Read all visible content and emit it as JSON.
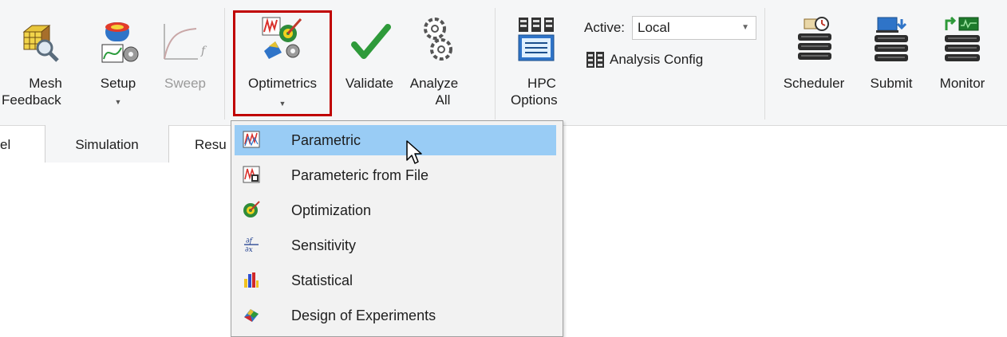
{
  "ribbon": {
    "mesh_line1": "Mesh",
    "mesh_line2": "Feedback",
    "setup": "Setup",
    "sweep": "Sweep",
    "optimetrics": "Optimetrics",
    "validate": "Validate",
    "analyze_line1": "Analyze",
    "analyze_line2": "All",
    "hpc_line1": "HPC",
    "hpc_line2": "Options",
    "active_label": "Active:",
    "active_value": "Local",
    "analysis_config": "Analysis Config",
    "scheduler": "Scheduler",
    "submit": "Submit",
    "monitor": "Monitor"
  },
  "tabs": {
    "partial_left": "el",
    "simulation": "Simulation",
    "partial_results": "Resu"
  },
  "menu": {
    "items": [
      {
        "label": "Parametric",
        "icon": "parametric-icon"
      },
      {
        "label": "Parameteric from File",
        "icon": "parametric-file-icon"
      },
      {
        "label": "Optimization",
        "icon": "optimization-icon"
      },
      {
        "label": "Sensitivity",
        "icon": "sensitivity-icon"
      },
      {
        "label": "Statistical",
        "icon": "statistical-icon"
      },
      {
        "label": "Design of Experiments",
        "icon": "doe-icon"
      }
    ],
    "selected_index": 0
  },
  "colors": {
    "highlight_border": "#c00000",
    "menu_selection": "#99ccf5",
    "validate_check": "#2e9a3a"
  }
}
